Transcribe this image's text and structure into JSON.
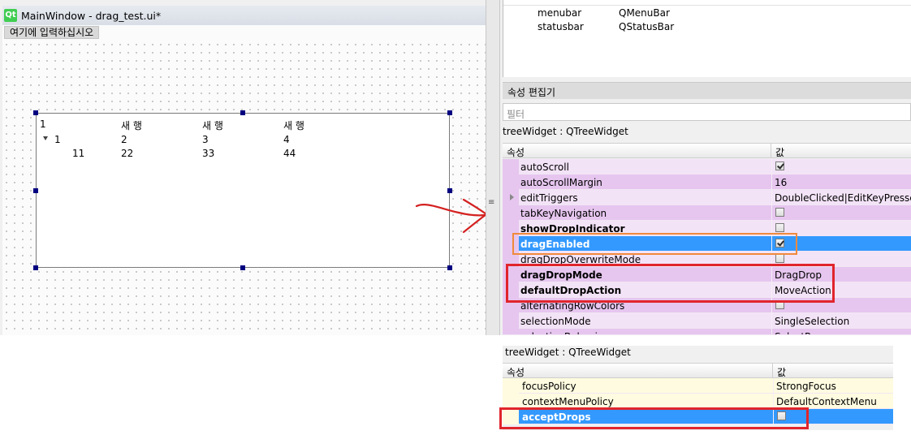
{
  "window": {
    "logo": "Qt",
    "title": "MainWindow - drag_test.ui*",
    "menu_placeholder": "여기에 입력하십시오"
  },
  "tree_widget": {
    "headers": [
      "1",
      "새 행",
      "새 행",
      "새 행"
    ],
    "rows": [
      {
        "cells": [
          "1",
          "2",
          "3",
          "4"
        ],
        "expanded": true
      },
      {
        "cells": [
          "11",
          "22",
          "33",
          "44"
        ],
        "child": true
      }
    ]
  },
  "object_inspector": {
    "rows": [
      {
        "name": "menubar",
        "class": "QMenuBar"
      },
      {
        "name": "statusbar",
        "class": "QStatusBar"
      }
    ]
  },
  "property_editor": {
    "title": "속성 편집기",
    "filter_placeholder": "필터",
    "class_label": "treeWidget : QTreeWidget",
    "col_property": "속성",
    "col_value": "값",
    "rows": [
      {
        "name": "autoScroll",
        "value": "",
        "checkbox": true,
        "checked": true
      },
      {
        "name": "autoScrollMargin",
        "value": "16"
      },
      {
        "name": "editTriggers",
        "value": "DoubleClicked|EditKeyPressed",
        "expandable": true
      },
      {
        "name": "tabKeyNavigation",
        "value": "",
        "checkbox": true,
        "checked": false
      },
      {
        "name": "showDropIndicator",
        "value": "",
        "checkbox": true,
        "checked": false,
        "bold": true
      },
      {
        "name": "dragEnabled",
        "value": "",
        "checkbox": true,
        "checked": true,
        "bold": true,
        "selected": true
      },
      {
        "name": "dragDropOverwriteMode",
        "value": "",
        "checkbox": true,
        "checked": false
      },
      {
        "name": "dragDropMode",
        "value": "DragDrop",
        "bold": true
      },
      {
        "name": "defaultDropAction",
        "value": "MoveAction",
        "bold": true
      },
      {
        "name": "alternatingRowColors",
        "value": "",
        "checkbox": true,
        "checked": false
      },
      {
        "name": "selectionMode",
        "value": "SingleSelection"
      },
      {
        "name": "selectionBehavior",
        "value": "SelectRows"
      }
    ]
  },
  "second_panel": {
    "class_label": "treeWidget : QTreeWidget",
    "col_property": "속성",
    "col_value": "값",
    "rows": [
      {
        "name": "focusPolicy",
        "value": "StrongFocus"
      },
      {
        "name": "contextMenuPolicy",
        "value": "DefaultContextMenu"
      },
      {
        "name": "acceptDrops",
        "value": "",
        "checkbox": true,
        "checked": false,
        "bold": true,
        "selected": true
      }
    ]
  },
  "colors": {
    "selection": "#3399ff",
    "row_dark": "#e6c6ef",
    "row_light": "#f3e3f7",
    "row_yellow": "#fffbe0",
    "highlight_orange": "#f08a3c",
    "highlight_red": "#e0252c",
    "arrow": "#d42020",
    "handle": "#000080"
  }
}
